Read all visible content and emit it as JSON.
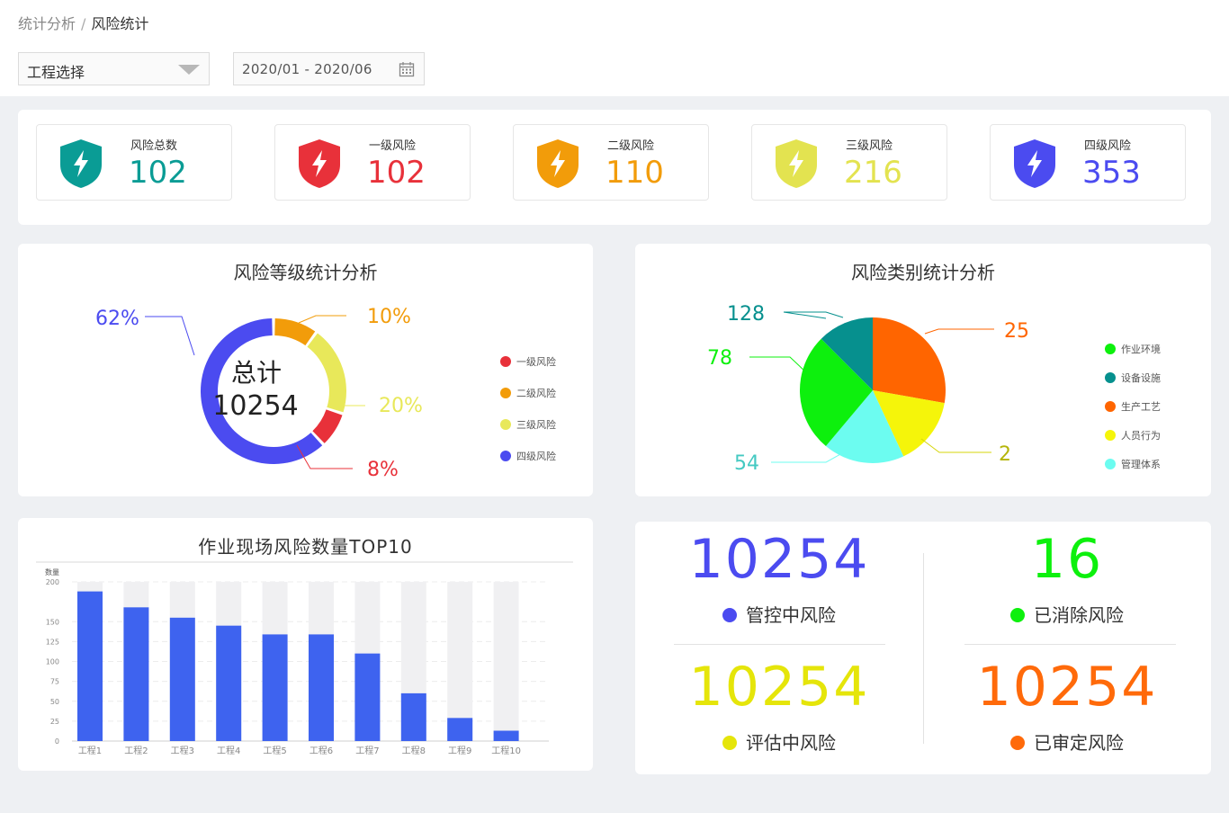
{
  "breadcrumb": {
    "parent": "统计分析",
    "separator": "/",
    "current": "风险统计"
  },
  "filters": {
    "project_select": {
      "value": "工程选择"
    },
    "date_range": {
      "value": "2020/01 - 2020/06"
    }
  },
  "summary": [
    {
      "label": "风险总数",
      "value": "102",
      "color": "#0a9c95"
    },
    {
      "label": "一级风险",
      "value": "102",
      "color": "#e8313a"
    },
    {
      "label": "二级风险",
      "value": "110",
      "color": "#f29c0a"
    },
    {
      "label": "三级风险",
      "value": "216",
      "color": "#e3e350"
    },
    {
      "label": "四级风险",
      "value": "353",
      "color": "#4b4bf0"
    }
  ],
  "level_chart": {
    "title": "风险等级统计分析",
    "center_label": "总计",
    "center_value": "10254",
    "chart_data": {
      "type": "pie",
      "slices": [
        {
          "name": "一级风险",
          "percent": 8,
          "label": "8%",
          "color": "#e8313a"
        },
        {
          "name": "二级风险",
          "percent": 10,
          "label": "10%",
          "color": "#f29c0a"
        },
        {
          "name": "三级风险",
          "percent": 20,
          "label": "20%",
          "color": "#e8e85a"
        },
        {
          "name": "四级风险",
          "percent": 62,
          "label": "62%",
          "color": "#4b4bf0"
        }
      ],
      "legend_position": "right"
    }
  },
  "category_chart": {
    "title": "风险类别统计分析",
    "chart_data": {
      "type": "pie",
      "slices": [
        {
          "name": "作业环境",
          "value": 78,
          "label": "78",
          "color": "#0df00d"
        },
        {
          "name": "设备设施",
          "value": 128,
          "label": "128",
          "color": "#06908e"
        },
        {
          "name": "生产工艺",
          "value": 25,
          "label": "25",
          "color": "#ff6500"
        },
        {
          "name": "人员行为",
          "value": 2,
          "label": "2",
          "color": "#f5f50a"
        },
        {
          "name": "管理体系",
          "value": 54,
          "label": "54",
          "color": "#6cfcf0"
        }
      ],
      "legend_position": "right"
    }
  },
  "top10_chart": {
    "title": "作业现场风险数量TOP10",
    "chart_data": {
      "type": "bar",
      "ylabel": "数量",
      "ylim": [
        0,
        200
      ],
      "yticks": [
        0,
        25,
        50,
        75,
        100,
        125,
        150,
        200
      ],
      "categories": [
        "工程1",
        "工程2",
        "工程3",
        "工程4",
        "工程5",
        "工程6",
        "工程7",
        "工程8",
        "工程9",
        "工程10"
      ],
      "values": [
        188,
        168,
        155,
        145,
        134,
        134,
        110,
        60,
        29,
        13
      ],
      "bar_color": "#3e63ef",
      "background_bar_color": "#f0f0f2"
    }
  },
  "big_numbers": [
    {
      "value": "10254",
      "label": "管控中风险",
      "color": "#4b4bf0"
    },
    {
      "value": "16",
      "label": "已消除风险",
      "color": "#0df00d"
    },
    {
      "value": "10254",
      "label": "评估中风险",
      "color": "#e5e50a"
    },
    {
      "value": "10254",
      "label": "已审定风险",
      "color": "#ff6a0a"
    }
  ]
}
